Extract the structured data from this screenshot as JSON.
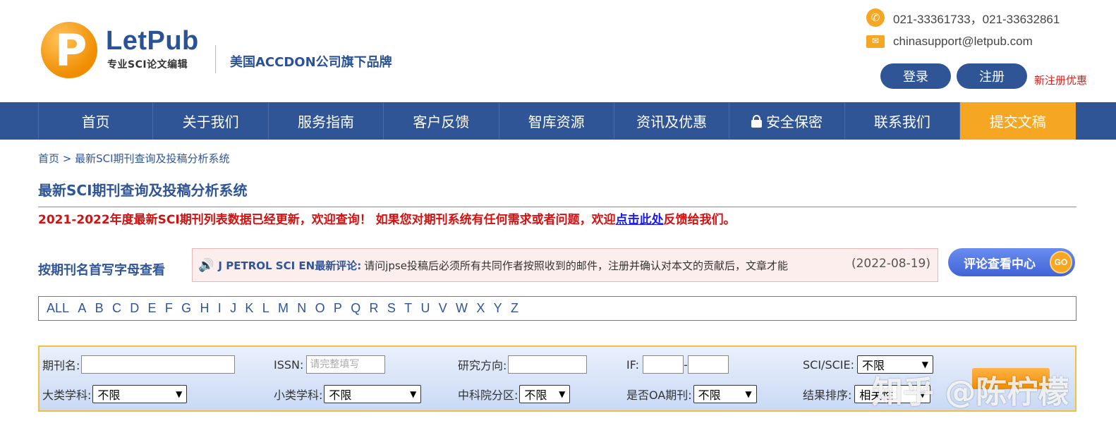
{
  "header": {
    "logo_letter": "P",
    "logo_name": "LetPub",
    "logo_sub": "专业SCI论文编辑",
    "brand": "美国ACCDON公司旗下品牌",
    "phone": "021-33361733，021-33632861",
    "email": "chinasupport@letpub.com",
    "login_label": "登录",
    "register_label": "注册",
    "promo": "新注册优惠",
    "icons": {
      "phone": "phone-icon",
      "mail": "mail-icon"
    },
    "accent_color": "#f5a623",
    "brand_color": "#2f5597"
  },
  "nav": {
    "items": [
      "首页",
      "关于我们",
      "服务指南",
      "客户反馈",
      "智库资源",
      "资讯及优惠",
      "安全保密",
      "联系我们",
      "提交文稿"
    ]
  },
  "breadcrumb": "首页 > 最新SCI期刊查询及投稿分析系统",
  "page_title": "最新SCI期刊查询及投稿分析系统",
  "notice": {
    "prefix": "2021-2022年度最新SCI期刊列表数据已经更新，欢迎查询！ 如果您对期刊系统有任何需求或者问题，欢迎",
    "link": "点击此处",
    "suffix": "反馈给我们。"
  },
  "alpha_label": "按期刊名首写字母查看",
  "comment": {
    "journal": "J PETROL SCI EN最新评论:",
    "text": "请问jpse投稿后必须所有共同作者按照收到的邮件，注册并确认对本文的贡献后，文章才能",
    "date": "(2022-08-19)",
    "button": "评论查看中心",
    "go": "GO"
  },
  "letters": [
    "ALL",
    "A",
    "B",
    "C",
    "D",
    "E",
    "F",
    "G",
    "H",
    "I",
    "J",
    "K",
    "L",
    "M",
    "N",
    "O",
    "P",
    "Q",
    "R",
    "S",
    "T",
    "U",
    "V",
    "W",
    "X",
    "Y",
    "Z"
  ],
  "search": {
    "journal_label": "期刊名:",
    "journal_value": "",
    "issn_label": "ISSN:",
    "issn_placeholder": "请完整填写",
    "research_label": "研究方向:",
    "if_label": "IF:",
    "if_sep": "-",
    "sci_label": "SCI/SCIE:",
    "sci_value": "不限",
    "major_label": "大类学科:",
    "major_value": "不限",
    "minor_label": "小类学科:",
    "minor_value": "不限",
    "cas_label": "中科院分区:",
    "cas_value": "不限",
    "oa_label": "是否OA期刊:",
    "oa_value": "不限",
    "sort_label": "结果排序:",
    "sort_value": "相关性"
  },
  "watermark": "知乎 @陈柠檬"
}
